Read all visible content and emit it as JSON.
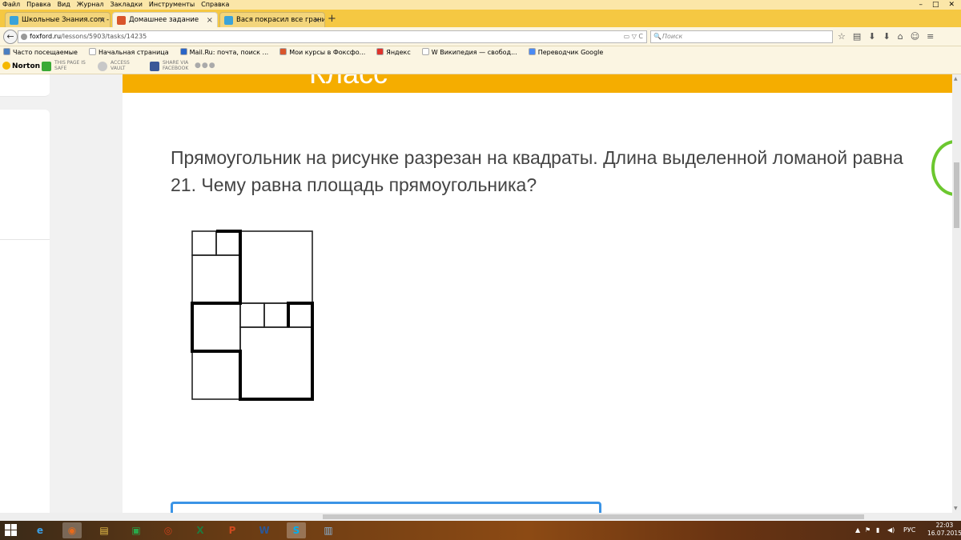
{
  "menu": {
    "items": [
      "Файл",
      "Правка",
      "Вид",
      "Журнал",
      "Закладки",
      "Инструменты",
      "Справка"
    ]
  },
  "window_controls": {
    "minimize": "–",
    "maximize": "□",
    "close": "✕"
  },
  "tabs": [
    {
      "label": "Школьные Знания.com - ...",
      "icon_color": "#3aa3d9",
      "active": false
    },
    {
      "label": "Домашнее задание",
      "icon_color": "#d9552b",
      "active": true
    },
    {
      "label": "Вася покрасил все грани ...",
      "icon_color": "#3aa3d9",
      "active": false
    }
  ],
  "new_tab_label": "+",
  "tab_close": "×",
  "navbar": {
    "back": "←",
    "url_domain": "foxford.ru",
    "url_path": "/lessons/5903/tasks/14235",
    "url_right": "▭ ▽ C",
    "search_icon": "🔍",
    "search_placeholder": "Поиск",
    "icons": [
      "☆",
      "▤",
      "⬇",
      "⬇",
      "⌂",
      "☺",
      "≡"
    ]
  },
  "bookmarks": [
    {
      "label": "Часто посещаемые",
      "icon_color": "#4a7fc1"
    },
    {
      "label": "Начальная страница",
      "icon_color": "#ffffff"
    },
    {
      "label": "Mail.Ru: почта, поиск ...",
      "icon_color": "#2a65c7"
    },
    {
      "label": "Мои курсы в Фоксфо...",
      "icon_color": "#d9552b"
    },
    {
      "label": "Яндекс",
      "icon_color": "#e0332b"
    },
    {
      "label": "W  Википедия — свобод...",
      "icon_color": "#ffffff"
    },
    {
      "label": "Переводчик Google",
      "icon_color": "#4a8af4"
    }
  ],
  "norton": {
    "logo": "Norton",
    "safe_line1": "THIS PAGE IS",
    "safe_line2": "SAFE",
    "vault_line1": "ACCESS",
    "vault_line2": "VAULT",
    "share_line1": "SHARE VIA",
    "share_line2": "FACEBOOK",
    "more": "●●●"
  },
  "page": {
    "banner_text": "Класс",
    "question": "Прямоугольник на рисунке разрезан на квадраты. Длина выделенной ломаной равна 21. Чему равна площадь прямоугольника?",
    "accent_orange": "#f5ad00",
    "answer_border": "#3b94e6",
    "ring_green": "#6cc72f"
  },
  "figure": {
    "description_units": "unit squares",
    "squares": [
      {
        "x": 0,
        "y": 0,
        "size": 1
      },
      {
        "x": 1,
        "y": 0,
        "size": 1
      },
      {
        "x": 2,
        "y": 0,
        "size": 3
      },
      {
        "x": 0,
        "y": 1,
        "size": 2
      },
      {
        "x": 0,
        "y": 3,
        "size": 2
      },
      {
        "x": 2,
        "y": 3,
        "size": 1
      },
      {
        "x": 3,
        "y": 3,
        "size": 1
      },
      {
        "x": 4,
        "y": 3,
        "size": 1
      },
      {
        "x": 2,
        "y": 4,
        "size": 3
      },
      {
        "x": 0,
        "y": 5,
        "size": 2
      }
    ],
    "bold_path": [
      [
        1,
        0
      ],
      [
        2,
        0
      ],
      [
        2,
        1
      ],
      [
        2,
        1
      ],
      [
        2,
        3
      ],
      [
        0,
        3
      ],
      [
        0,
        5
      ],
      [
        2,
        5
      ],
      [
        2,
        7
      ],
      [
        5,
        7
      ],
      [
        5,
        3
      ],
      [
        4,
        3
      ],
      [
        4,
        4
      ]
    ]
  },
  "taskbar": {
    "apps": [
      {
        "label": "e",
        "name": "internet-explorer-icon",
        "color": "#3aa0e8",
        "active": false
      },
      {
        "label": "◉",
        "name": "firefox-icon",
        "color": "#e86a1a",
        "active": true
      },
      {
        "label": "▤",
        "name": "file-explorer-icon",
        "color": "#e8c04a",
        "active": false
      },
      {
        "label": "▣",
        "name": "store-icon",
        "color": "#2aa84a",
        "active": false
      },
      {
        "label": "◎",
        "name": "eye-app-icon",
        "color": "#c8401a",
        "active": false
      },
      {
        "label": "X",
        "name": "excel-icon",
        "color": "#1f7a3e",
        "active": false
      },
      {
        "label": "P",
        "name": "powerpoint-icon",
        "color": "#d04a1e",
        "active": false
      },
      {
        "label": "W",
        "name": "word-icon",
        "color": "#2b5797",
        "active": false
      },
      {
        "label": "S",
        "name": "skype-icon",
        "color": "#00aff0",
        "active": true
      },
      {
        "label": "▥",
        "name": "notepad-icon",
        "color": "#8ab4d8",
        "active": false
      }
    ],
    "tray_up": "▲",
    "tray_flag": "⚑",
    "tray_signal": "▮",
    "tray_sound": "◀)",
    "language": "РУС",
    "time": "22:03",
    "date": "16.07.2015"
  }
}
